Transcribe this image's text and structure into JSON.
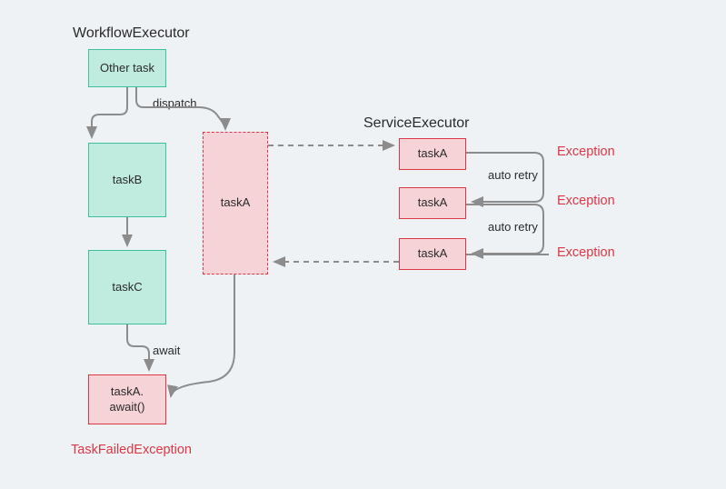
{
  "headings": {
    "workflow": "WorkflowExecutor",
    "service": "ServiceExecutor"
  },
  "boxes": {
    "other_task": "Other task",
    "taskB": "taskB",
    "taskC": "taskC",
    "await_box": "taskA.\nawait()",
    "taskA_dispatch": "taskA",
    "svc_taskA1": "taskA",
    "svc_taskA2": "taskA",
    "svc_taskA3": "taskA"
  },
  "labels": {
    "dispatch": "dispatch",
    "await": "await",
    "auto_retry1": "auto retry",
    "auto_retry2": "auto retry"
  },
  "exceptions": {
    "e1": "Exception",
    "e2": "Exception",
    "e3": "Exception",
    "task_failed": "TaskFailedException"
  }
}
